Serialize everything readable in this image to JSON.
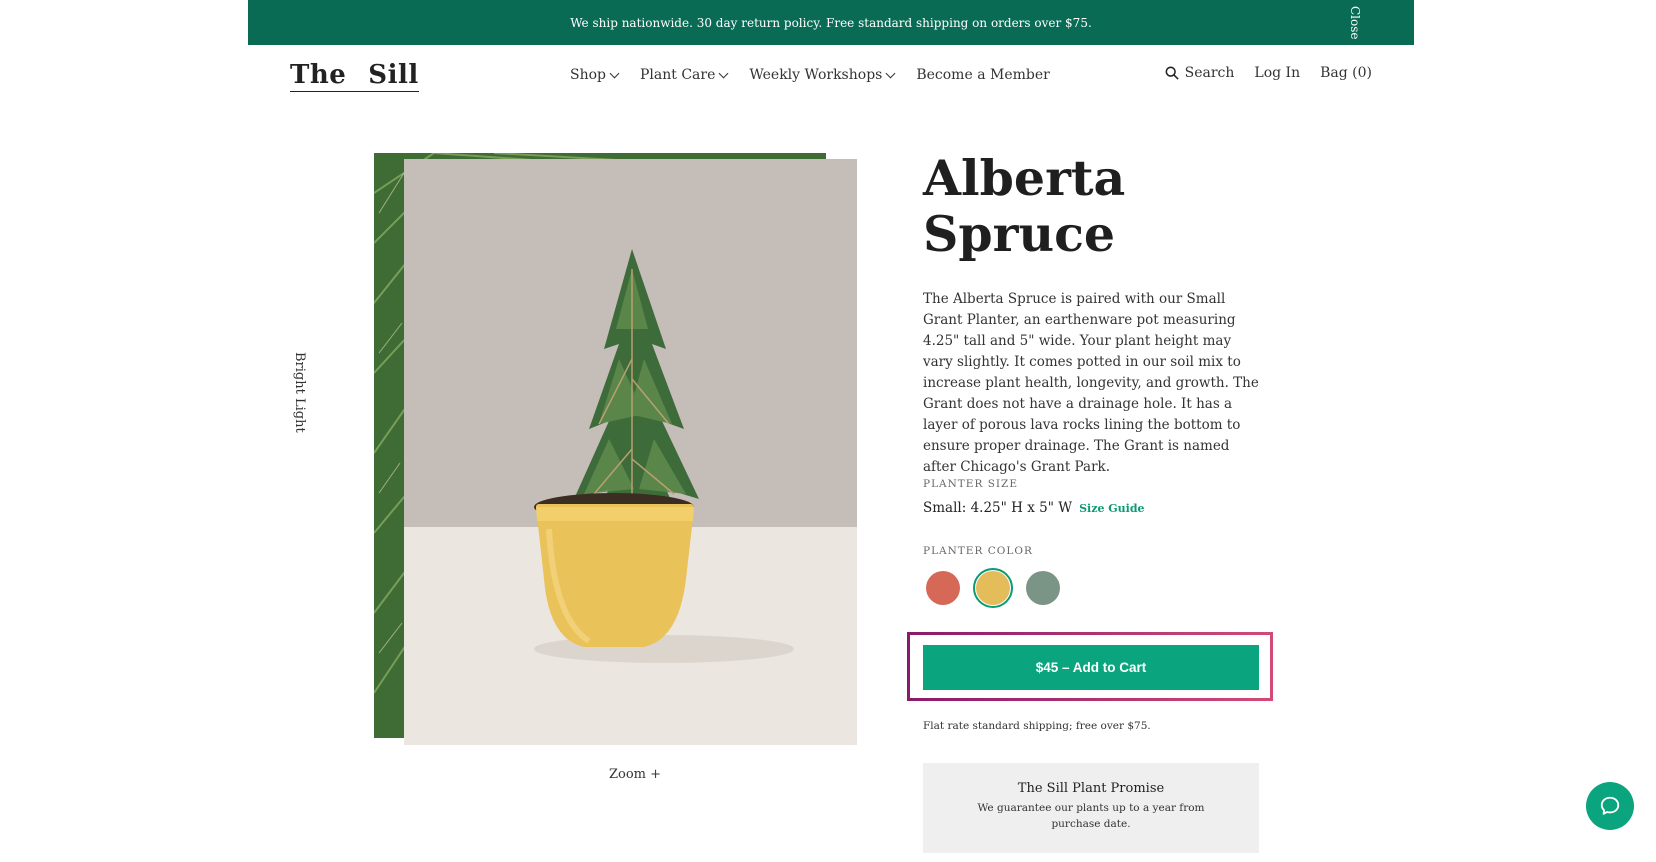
{
  "banner": {
    "text": "We ship nationwide. 30 day return policy. Free standard shipping on orders over $75.",
    "close_label": "Close"
  },
  "header": {
    "logo_left": "The",
    "logo_right": "Sill",
    "nav": [
      {
        "label": "Shop",
        "has_dropdown": true
      },
      {
        "label": "Plant Care",
        "has_dropdown": true
      },
      {
        "label": "Weekly Workshops",
        "has_dropdown": true
      },
      {
        "label": "Become a Member",
        "has_dropdown": false
      }
    ],
    "search_label": "Search",
    "login_label": "Log In",
    "bag_label": "Bag (0)"
  },
  "gallery": {
    "light_label": "Bright Light",
    "zoom_label": "Zoom +"
  },
  "product": {
    "title_line1": "Alberta",
    "title_line2": "Spruce",
    "description": "The Alberta Spruce is paired with our Small Grant Planter, an earthenware pot measuring 4.25\" tall and 5\" wide. Your plant height may vary slightly. It comes potted in our soil mix to increase plant health, longevity, and growth. The Grant does not have a drainage hole. It has a layer of porous lava rocks lining the bottom to ensure proper drainage. The Grant is named after Chicago's Grant Park.",
    "planter_size_label": "PLANTER SIZE",
    "planter_size_value": "Small: 4.25\" H x 5\" W",
    "size_guide_label": "Size Guide",
    "planter_color_label": "PLANTER COLOR",
    "colors": [
      {
        "name": "terracotta",
        "hex": "#d66858",
        "selected": false
      },
      {
        "name": "mustard",
        "hex": "#e4bc5a",
        "selected": true
      },
      {
        "name": "sage",
        "hex": "#7a9486",
        "selected": false
      }
    ],
    "add_to_cart_label": "$45 – Add to Cart",
    "shipping_note": "Flat rate standard shipping; free over $75.",
    "promise_title": "The Sill Plant Promise",
    "promise_text": "We guarantee our plants up to a year from purchase date."
  },
  "chat": {
    "icon": "chat-bubble-icon"
  },
  "colors": {
    "banner_bg": "#0a6b55",
    "accent": "#0aa57e"
  }
}
